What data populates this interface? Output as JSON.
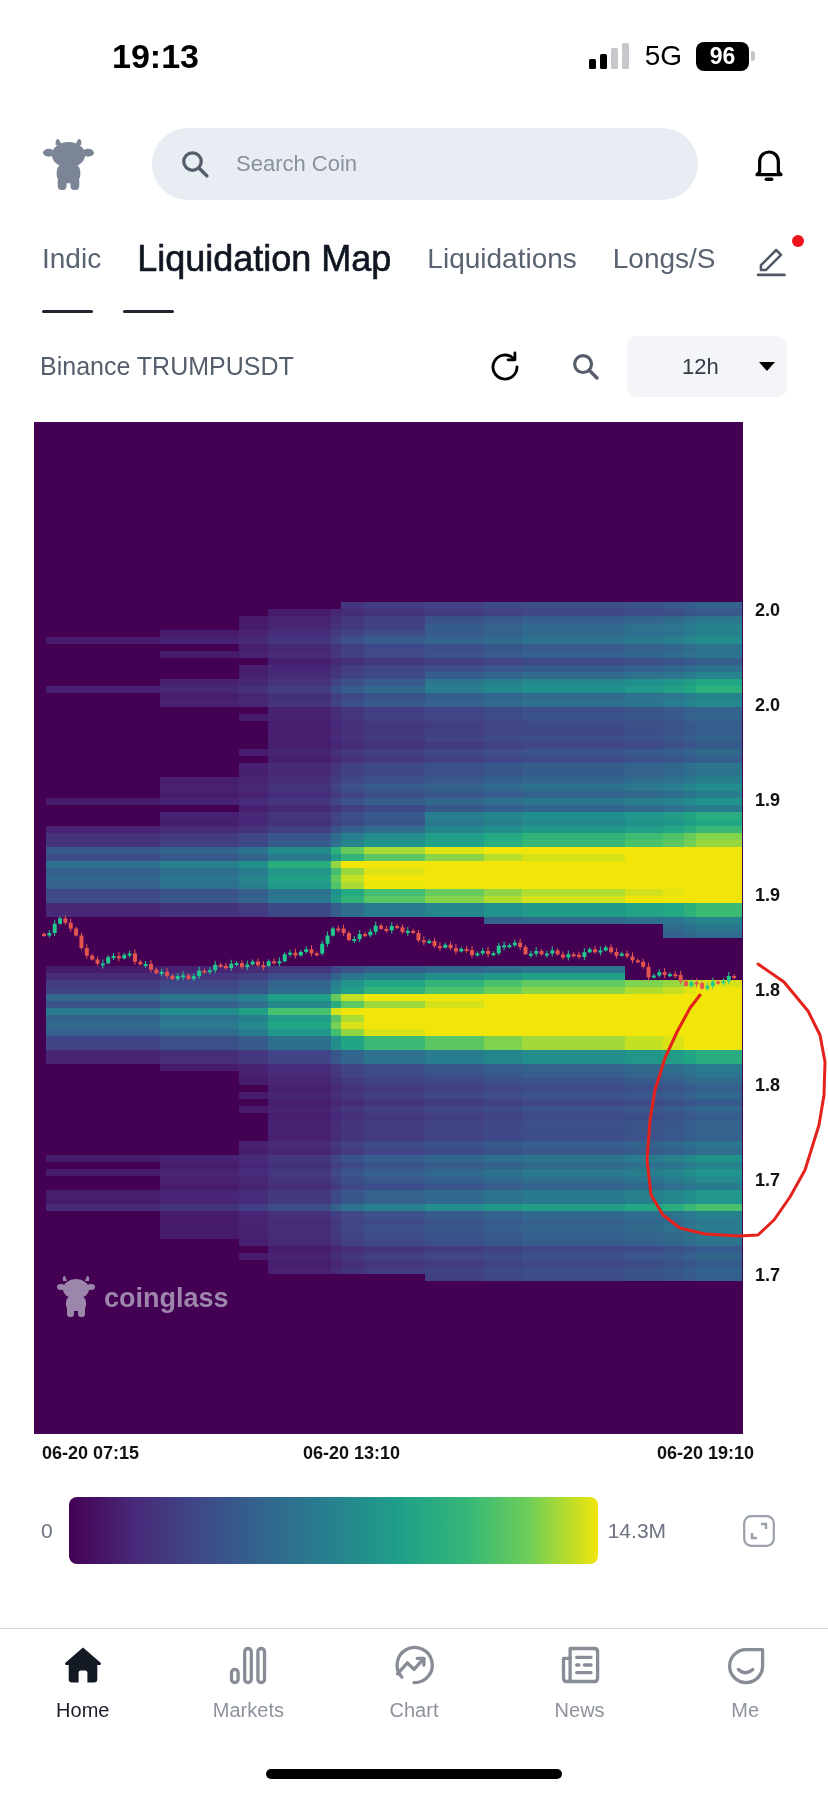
{
  "status_bar": {
    "time": "19:13",
    "network": "5G",
    "battery": "96"
  },
  "header": {
    "search": {
      "placeholder": "Search Coin"
    }
  },
  "tabs": [
    {
      "label": "Indic",
      "selected": false
    },
    {
      "label": "Liquidation Map",
      "selected": true
    },
    {
      "label": "Liquidations",
      "selected": false
    },
    {
      "label": "Longs/S",
      "selected": false
    }
  ],
  "edit_button": {
    "badge": true
  },
  "toolbar": {
    "pair": "Binance TRUMPUSDT",
    "interval": "12h"
  },
  "chart": {
    "y_labels": [
      "2.0",
      "2.0",
      "1.9",
      "1.9",
      "1.8",
      "1.8",
      "1.7",
      "1.7"
    ],
    "x_labels": [
      "06-20 07:15",
      "06-20 13:10",
      "06-20 19:10"
    ],
    "watermark": "coinglass"
  },
  "legend": {
    "min": "0",
    "max": "14.3M"
  },
  "bottom_nav": [
    {
      "label": "Home",
      "kind": "home",
      "selected": true
    },
    {
      "label": "Markets",
      "kind": "markets",
      "selected": false
    },
    {
      "label": "Chart",
      "kind": "chart",
      "selected": false
    },
    {
      "label": "News",
      "kind": "news",
      "selected": false
    },
    {
      "label": "Me",
      "kind": "me",
      "selected": false
    }
  ]
}
